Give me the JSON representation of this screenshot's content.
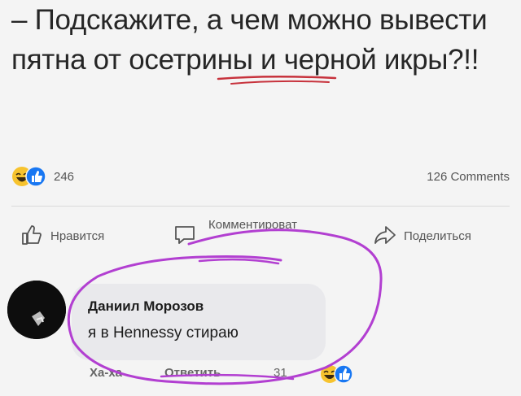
{
  "post": {
    "text": "– Подскажите, а чем можно вывести пятна от осетрины и черной икры?!!"
  },
  "reactions": {
    "icons": [
      "haha-emoji-icon",
      "like-thumb-icon"
    ],
    "count": "246",
    "comments": "126 Comments"
  },
  "actions": {
    "like": "Нравится",
    "comment": "Комментироват",
    "share": "Поделиться"
  },
  "comment": {
    "author": "Даниил Морозов",
    "text": "я в Hennessy стираю",
    "haha": "Ха-ха",
    "reply": "Ответить",
    "reaction_count": "31"
  },
  "colors": {
    "annotation_red": "#c7323c",
    "annotation_purple": "#b23fd1",
    "like_blue": "#1877f2",
    "emoji_yellow": "#f7c32e"
  }
}
